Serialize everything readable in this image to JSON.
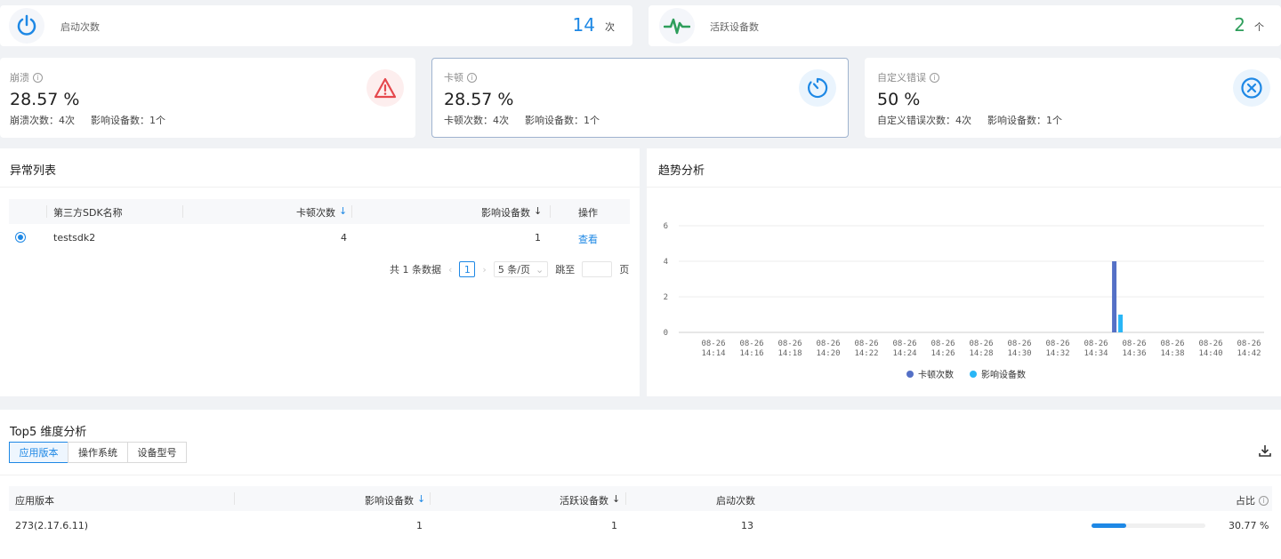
{
  "top_stats": {
    "launches": {
      "label": "启动次数",
      "value": "14",
      "unit": "次"
    },
    "active_devices": {
      "label": "活跃设备数",
      "value": "2",
      "unit": "个"
    }
  },
  "metric_cards": [
    {
      "title": "崩溃",
      "value": "28.57 %",
      "count_label": "崩溃次数：",
      "count": "4次",
      "device_label": "影响设备数：",
      "devices": "1个",
      "icon": "warning-triangle-icon",
      "color": "#e5484d"
    },
    {
      "title": "卡顿",
      "value": "28.57 %",
      "count_label": "卡顿次数：",
      "count": "4次",
      "device_label": "影响设备数：",
      "devices": "1个",
      "icon": "timer-icon",
      "color": "#1e88e5"
    },
    {
      "title": "自定义错误",
      "value": "50 %",
      "count_label": "自定义错误次数：",
      "count": "4次",
      "device_label": "影响设备数：",
      "devices": "1个",
      "icon": "close-circle-icon",
      "color": "#1e88e5"
    }
  ],
  "exception_list": {
    "title": "异常列表",
    "columns": [
      "第三方SDK名称",
      "卡顿次数",
      "影响设备数",
      "操作"
    ],
    "rows": [
      {
        "name": "testsdk2",
        "count": "4",
        "devices": "1",
        "action": "查看"
      }
    ],
    "pagination": {
      "total": "共 1 条数据",
      "page": "1",
      "page_size": "5 条/页",
      "jump_label": "跳至",
      "page_suffix": "页"
    }
  },
  "trend": {
    "title": "趋势分析",
    "legend": [
      "卡顿次数",
      "影响设备数"
    ]
  },
  "chart_data": {
    "type": "bar",
    "categories": [
      "08-26 14:14",
      "08-26 14:16",
      "08-26 14:18",
      "08-26 14:20",
      "08-26 14:22",
      "08-26 14:24",
      "08-26 14:26",
      "08-26 14:28",
      "08-26 14:30",
      "08-26 14:32",
      "08-26 14:34",
      "08-26 14:36",
      "08-26 14:38",
      "08-26 14:40",
      "08-26 14:42"
    ],
    "x_positions": [
      0,
      1,
      2,
      3,
      4,
      5,
      6,
      7,
      8,
      9,
      10,
      11,
      12,
      13,
      14
    ],
    "bar_x": 10.56,
    "series": [
      {
        "name": "卡顿次数",
        "color": "#5470c6",
        "values": [
          0,
          0,
          0,
          0,
          0,
          0,
          0,
          0,
          0,
          0,
          4,
          0,
          0,
          0,
          0
        ]
      },
      {
        "name": "影响设备数",
        "color": "#29b6f6",
        "values": [
          0,
          0,
          0,
          0,
          0,
          0,
          0,
          0,
          0,
          0,
          1,
          0,
          0,
          0,
          0
        ]
      }
    ],
    "yticks": [
      "0",
      "2",
      "4",
      "6"
    ],
    "ylim": [
      0,
      6
    ],
    "grid": true,
    "legend_position": "bottom"
  },
  "top5": {
    "title": "Top5 维度分析",
    "tabs": [
      "应用版本",
      "操作系统",
      "设备型号"
    ],
    "columns": [
      "应用版本",
      "影响设备数",
      "活跃设备数",
      "启动次数",
      "占比"
    ],
    "rows": [
      {
        "version": "273(2.17.6.11)",
        "affected": "1",
        "active": "1",
        "launches": "13",
        "ratio": "30.77 %",
        "ratio_value": 0.3077
      }
    ]
  }
}
